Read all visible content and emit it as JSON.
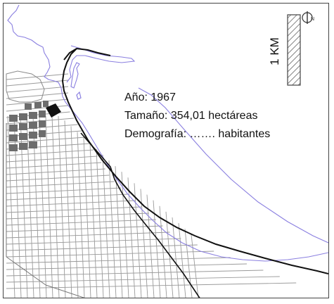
{
  "map": {
    "info": {
      "year_label": "Año:",
      "year_value": "1967",
      "size_label": "Tamaño:",
      "size_value": "354,01 hectáreas",
      "demography_label": "Demografía:",
      "demography_value": "……. habitantes"
    },
    "scale_bar": {
      "label": "1 KM"
    },
    "north_arrow": {
      "label": "N"
    },
    "colors": {
      "coastline": "#8a7fe0",
      "railway": "#111111",
      "streets": "#8f8f8f",
      "dense_blocks": "#6d6d6d",
      "historic_center": "#111111",
      "frame": "#444444"
    }
  }
}
